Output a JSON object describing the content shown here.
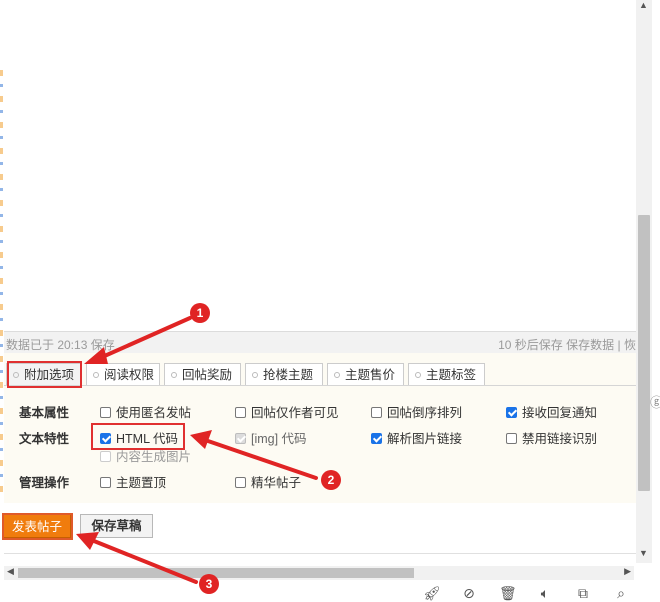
{
  "status_bar": {
    "saved_text": "数据已于 20:13 保存",
    "autosave_text": "10 秒后保存",
    "save_data_label": "保存数据",
    "separator_text": "|",
    "cut_char": "恢"
  },
  "tabs": [
    {
      "label": "附加选项",
      "active": true
    },
    {
      "label": "阅读权限",
      "active": false
    },
    {
      "label": "回帖奖励",
      "active": false
    },
    {
      "label": "抢楼主题",
      "active": false
    },
    {
      "label": "主题售价",
      "active": false
    },
    {
      "label": "主题标签",
      "active": false
    }
  ],
  "options": {
    "basic": {
      "label": "基本属性",
      "items": [
        {
          "label": "使用匿名发帖",
          "checked": false
        },
        {
          "label": "回帖仅作者可见",
          "checked": false
        },
        {
          "label": "回帖倒序排列",
          "checked": false
        },
        {
          "label": "接收回复通知",
          "checked": true
        }
      ]
    },
    "text": {
      "label": "文本特性",
      "items": [
        {
          "label": "HTML 代码",
          "checked": true
        },
        {
          "label": "[img] 代码",
          "checked": true,
          "disabled": true
        },
        {
          "label": "解析图片链接",
          "checked": true
        },
        {
          "label": "禁用链接识别",
          "checked": false
        }
      ],
      "overlap_label": "内容生成图片"
    },
    "admin": {
      "label": "管理操作",
      "items": [
        {
          "label": "主题置顶",
          "checked": false
        },
        {
          "label": "精华帖子",
          "checked": false
        }
      ]
    }
  },
  "buttons": {
    "submit": "发表帖子",
    "draft": "保存草稿"
  },
  "annotations": [
    "1",
    "2",
    "3"
  ],
  "icons": {
    "toolbar": [
      "rocket-icon",
      "compass-icon",
      "trash-icon",
      "speaker-icon",
      "copy-icon",
      "search-icon"
    ]
  },
  "colors": {
    "accent": "#f07c0d",
    "highlight": "#e03030",
    "checkbox": "#1a73e8"
  }
}
